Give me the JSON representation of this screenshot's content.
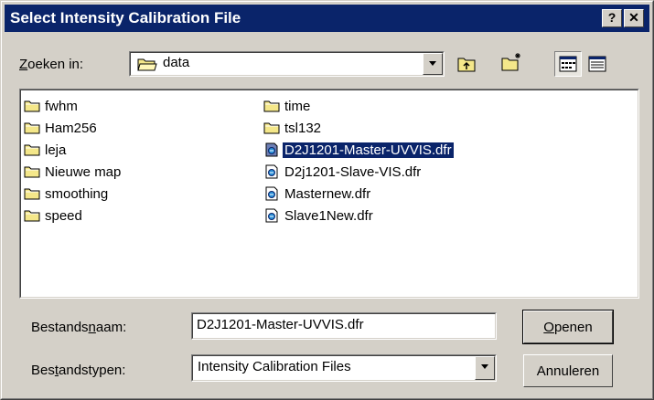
{
  "window": {
    "title": "Select Intensity Calibration File",
    "help_label": "?",
    "close_label": "✕"
  },
  "lookin": {
    "label_prefix": "Z",
    "label_rest": "oeken in:",
    "value": "data"
  },
  "files": {
    "column1": [
      {
        "name": "fwhm",
        "type": "folder"
      },
      {
        "name": "Ham256",
        "type": "folder"
      },
      {
        "name": "leja",
        "type": "folder"
      },
      {
        "name": "Nieuwe map",
        "type": "folder"
      },
      {
        "name": "smoothing",
        "type": "folder"
      },
      {
        "name": "speed",
        "type": "folder"
      }
    ],
    "column2": [
      {
        "name": "time",
        "type": "folder"
      },
      {
        "name": "tsl132",
        "type": "folder"
      },
      {
        "name": "D2J1201-Master-UVVIS.dfr",
        "type": "file",
        "selected": true
      },
      {
        "name": "D2j1201-Slave-VIS.dfr",
        "type": "file"
      },
      {
        "name": "Masternew.dfr",
        "type": "file"
      },
      {
        "name": "Slave1New.dfr",
        "type": "file"
      }
    ]
  },
  "filename": {
    "label_pre": "Bestands",
    "label_mn": "n",
    "label_post": "aam:",
    "value": "D2J1201-Master-UVVIS.dfr"
  },
  "filetype": {
    "label_pre": "Bes",
    "label_mn": "t",
    "label_post": "andstypen:",
    "value": "Intensity Calibration Files"
  },
  "buttons": {
    "open_mn": "O",
    "open_rest": "penen",
    "cancel": "Annuleren"
  },
  "colors": {
    "titlebar": "#0a246a",
    "face": "#d4d0c8",
    "folder": "#f4e78a"
  }
}
